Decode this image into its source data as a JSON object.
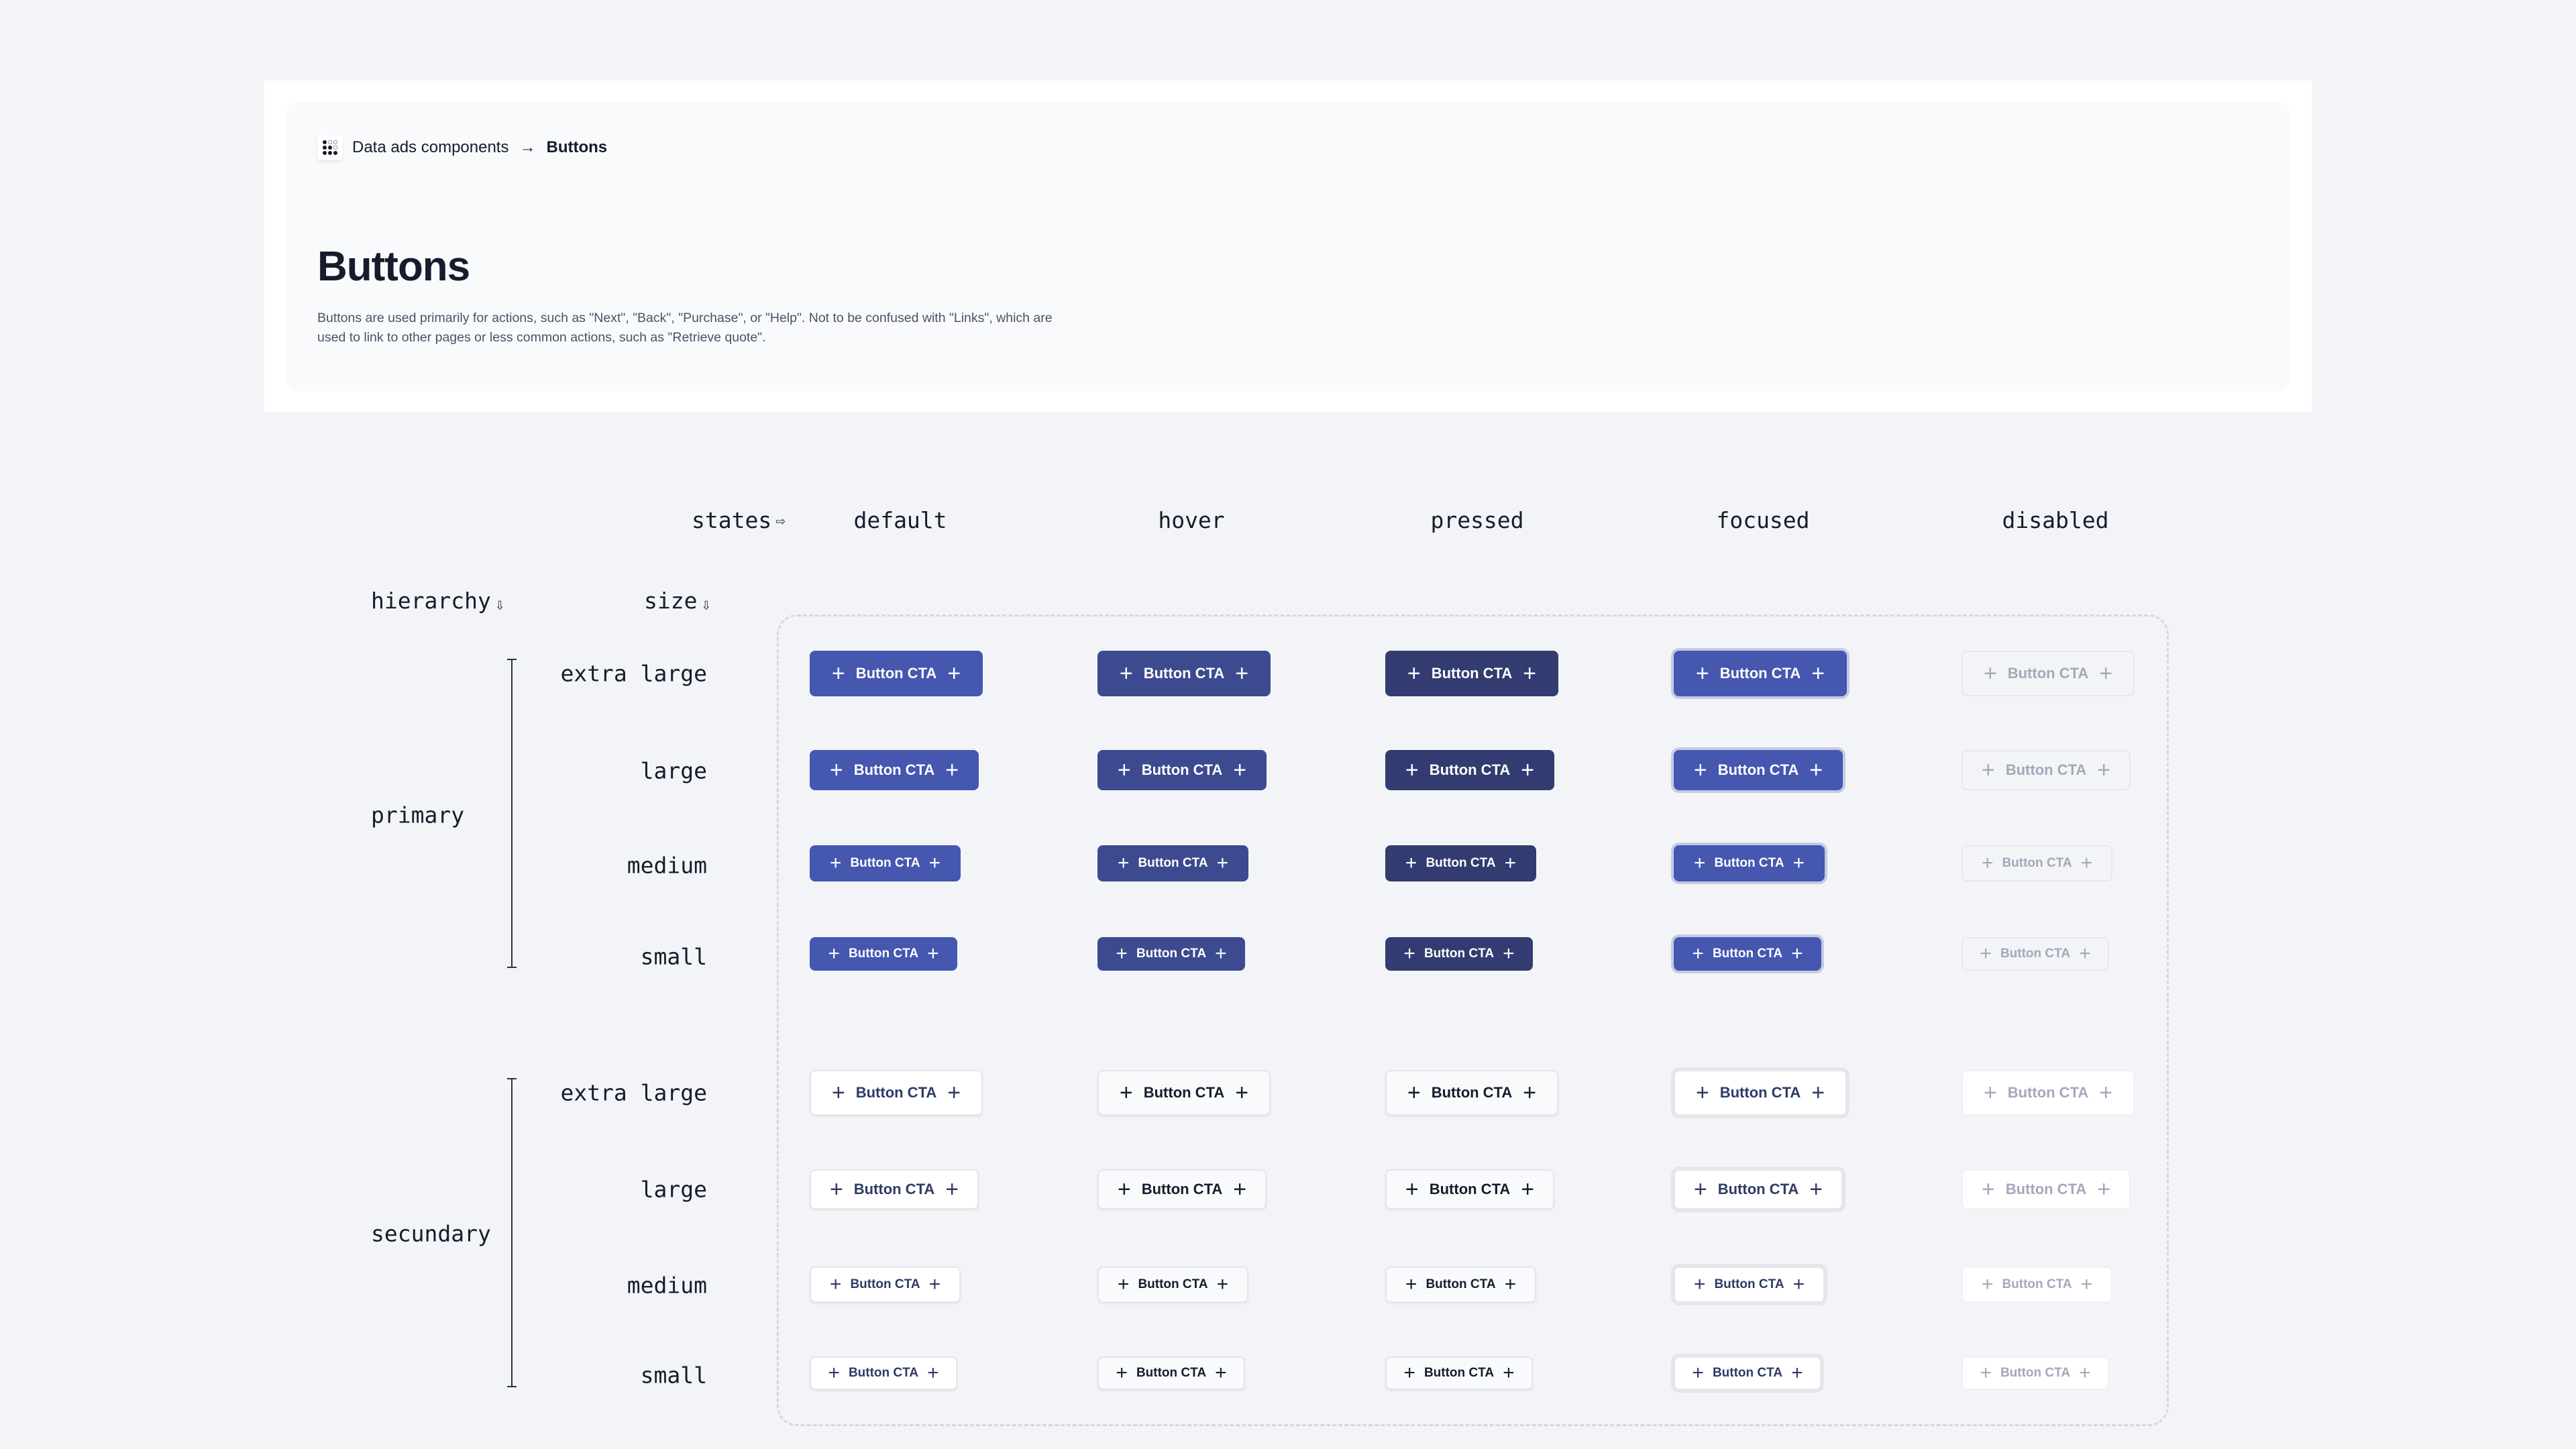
{
  "breadcrumb": {
    "logo_icon": "grid-dots-logo-icon",
    "parent": "Data ads components",
    "separator": "→",
    "current": "Buttons"
  },
  "page": {
    "title": "Buttons",
    "description": "Buttons are used primarily for actions, such as \"Next\", \"Back\", \"Purchase\", or \"Help\". Not to be confused with \"Links\", which are used to link to other pages or less common actions, such as \"Retrieve quote\"."
  },
  "matrix": {
    "states_label": "states",
    "states_arrow": "⇨",
    "hierarchy_label": "hierarchy",
    "hierarchy_arrow": "⇩",
    "size_label": "size",
    "size_arrow": "⇩",
    "states": [
      "default",
      "hover",
      "pressed",
      "focused",
      "disabled"
    ],
    "sizes": [
      "extra large",
      "large",
      "medium",
      "small"
    ],
    "hierarchies": [
      "primary",
      "secundary"
    ],
    "button_label": "Button CTA",
    "button_icon": "plus-icon",
    "icon_glyph": "+"
  },
  "colors": {
    "primary_default": "#4557AF",
    "primary_hover": "#3D4A8F",
    "primary_pressed": "#323C70",
    "focus_ring_primary": "#C5CAE6",
    "focus_ring_secondary": "#E4E6EB",
    "disabled_text": "#A3A8BA",
    "secondary_text": "#2F3A66"
  }
}
